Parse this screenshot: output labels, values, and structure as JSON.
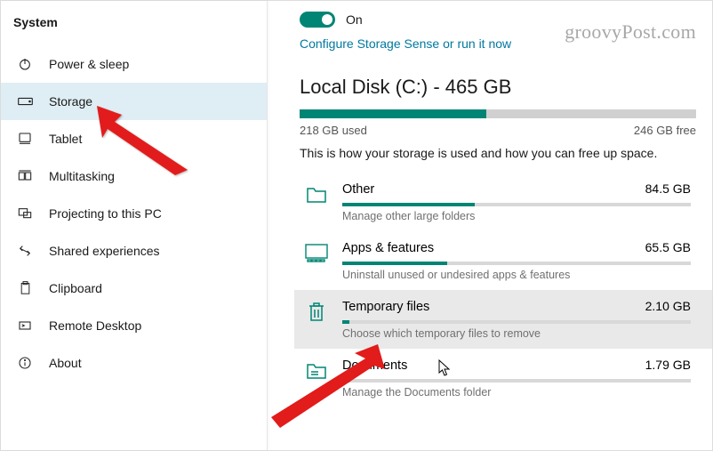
{
  "watermark": "groovyPost.com",
  "sidebar": {
    "title": "System",
    "items": [
      {
        "label": "Power & sleep",
        "icon": "power-icon",
        "selected": false
      },
      {
        "label": "Storage",
        "icon": "drive-icon",
        "selected": true
      },
      {
        "label": "Tablet",
        "icon": "tablet-icon",
        "selected": false
      },
      {
        "label": "Multitasking",
        "icon": "multitask-icon",
        "selected": false
      },
      {
        "label": "Projecting to this PC",
        "icon": "project-icon",
        "selected": false
      },
      {
        "label": "Shared experiences",
        "icon": "link-icon",
        "selected": false
      },
      {
        "label": "Clipboard",
        "icon": "clipboard-icon",
        "selected": false
      },
      {
        "label": "Remote Desktop",
        "icon": "remote-icon",
        "selected": false
      },
      {
        "label": "About",
        "icon": "info-icon",
        "selected": false
      }
    ]
  },
  "storage_sense": {
    "toggle_state": "On",
    "configure_link": "Configure Storage Sense or run it now"
  },
  "disk": {
    "title": "Local Disk (C:) - 465 GB",
    "used_label": "218 GB used",
    "free_label": "246 GB free",
    "fill_percent": 47,
    "description": "This is how your storage is used and how you can free up space."
  },
  "categories": [
    {
      "name": "Other",
      "size": "84.5 GB",
      "sub": "Manage other large folders",
      "fill": 38,
      "icon": "folder-icon",
      "hl": false
    },
    {
      "name": "Apps & features",
      "size": "65.5 GB",
      "sub": "Uninstall unused or undesired apps & features",
      "fill": 30,
      "icon": "apps-icon",
      "hl": false
    },
    {
      "name": "Temporary files",
      "size": "2.10 GB",
      "sub": "Choose which temporary files to remove",
      "fill": 2,
      "icon": "trash-icon",
      "hl": true
    },
    {
      "name": "Documents",
      "size": "1.79 GB",
      "sub": "Manage the Documents folder",
      "fill": 2,
      "icon": "documents-icon",
      "hl": false
    }
  ]
}
